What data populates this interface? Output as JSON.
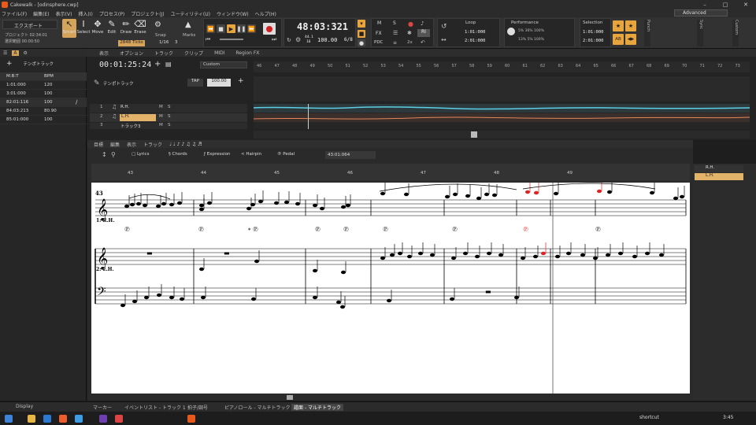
{
  "window": {
    "title": "Cakewalk - [odinsphere.cwp]"
  },
  "menu": [
    "ファイル(F)",
    "編集(E)",
    "表示(V)",
    "挿入(I)",
    "プロセス(P)",
    "プロジェクト(J)",
    "ユーティリティ(U)",
    "ウィンドウ(W)",
    "ヘルプ(H)"
  ],
  "workspace": "Advanced",
  "control_bar": {
    "export_label": "エクスポート",
    "project_time": "プロジェクト 02:34:01",
    "select_time": "選択範囲 00:00:50",
    "tools": [
      "Smart",
      "Select",
      "Move",
      "Edit",
      "Draw",
      "Erase"
    ],
    "snap_label": "Snap",
    "snap_value": "1/16",
    "snap_count": "3",
    "marks_label": "Marks",
    "ticks_badge": "2848 Ticks",
    "time_display": "48:03:321",
    "tempo": "100.00",
    "meter": "6/8",
    "sig_top": "44.1",
    "sig_bottom": "16",
    "fx_label": "FX",
    "pdc_label": "PDC",
    "m_label": "M",
    "s_label": "S",
    "ri_label": "RI",
    "loop_label": "Loop",
    "loop_start": "1:01:000",
    "loop_end": "2:01:000",
    "perf_label": "Performance",
    "perf_values": [
      "5%",
      "36%",
      "100%"
    ],
    "perf_values2": [
      "13%",
      "5%",
      "100%"
    ],
    "selection_label": "Selection",
    "sel_start": "1:01:000",
    "sel_end": "2:01:000",
    "ab_label": "AB",
    "side_labels": [
      "Punch",
      "Sync",
      "Custom"
    ]
  },
  "track_view": {
    "menus": [
      "表示",
      "オプション",
      "トラック",
      "クリップ",
      "MIDI",
      "Region FX"
    ],
    "now_time": "00:01:25:24",
    "custom": "Custom",
    "tempo_track": "テンポトラック",
    "tap": "TAP",
    "tap_value": "100.00",
    "ruler": [
      "46",
      "47",
      "48",
      "49",
      "50",
      "51",
      "52",
      "53",
      "54",
      "55",
      "56",
      "57",
      "58",
      "59",
      "60",
      "61",
      "62",
      "63",
      "64",
      "65",
      "66",
      "67",
      "68",
      "69",
      "70",
      "71",
      "72",
      "73"
    ],
    "tracks": [
      {
        "num": "1",
        "name": "R.H.",
        "m": "M",
        "s": "S"
      },
      {
        "num": "2",
        "name": "L.H.",
        "m": "M",
        "s": "S"
      },
      {
        "num": "3",
        "name": "トラック3",
        "m": "M",
        "s": "S"
      }
    ]
  },
  "tempo_panel": {
    "title": "テンポトラック",
    "col1": "M:B:T",
    "col2": "BPM",
    "rows": [
      {
        "mbt": "1:01:000",
        "bpm": "120"
      },
      {
        "mbt": "3:01:000",
        "bpm": "100"
      },
      {
        "mbt": "82:01:116",
        "bpm": "100"
      },
      {
        "mbt": "84:03:213",
        "bpm": "80.90"
      },
      {
        "mbt": "85:01:000",
        "bpm": "100"
      }
    ]
  },
  "staff_view": {
    "menus": [
      "目標",
      "編集",
      "表示",
      "トラック"
    ],
    "tools": [
      "Lyrics",
      "Chords",
      "Expression",
      "Hairpin",
      "Pedal"
    ],
    "position": "43:01:064",
    "ruler": [
      "43",
      "44",
      "45",
      "46",
      "47",
      "48",
      "49"
    ],
    "measure_number": "43",
    "staff_labels": [
      "1:\nR.H.",
      "2:\nL.H."
    ],
    "tracks": [
      "R.H.",
      "L.H."
    ]
  },
  "bottom_tabs": [
    "マーカー",
    "イベントリスト - トラック 1",
    "拍子/調号",
    "ピアノロール - マルチトラック",
    "譜面 - マルチトラック"
  ],
  "display_label": "Display",
  "taskbar": {
    "shortcut": "shortcut",
    "time": "3:45"
  }
}
